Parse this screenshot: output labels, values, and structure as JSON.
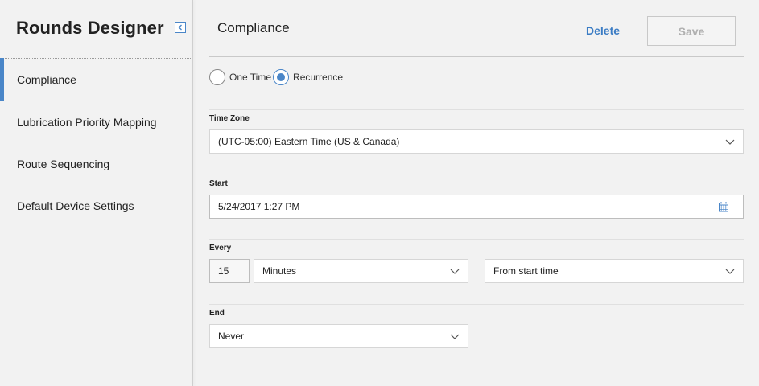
{
  "sidebar": {
    "title": "Rounds Designer",
    "items": [
      {
        "label": "Compliance",
        "active": true
      },
      {
        "label": "Lubrication Priority Mapping",
        "active": false
      },
      {
        "label": "Route Sequencing",
        "active": false
      },
      {
        "label": "Default Device Settings",
        "active": false
      }
    ],
    "collapse_icon": "collapse-left-icon"
  },
  "header": {
    "title": "Compliance",
    "delete_label": "Delete",
    "save_label": "Save"
  },
  "schedule_type": {
    "options": [
      "One Time",
      "Recurrence"
    ],
    "selected": "Recurrence"
  },
  "time_zone": {
    "label": "Time Zone",
    "value": "(UTC-05:00) Eastern Time (US & Canada)"
  },
  "start": {
    "label": "Start",
    "value": "5/24/2017 1:27 PM"
  },
  "every": {
    "label": "Every",
    "count": "15",
    "unit": "Minutes",
    "basis": "From start time"
  },
  "end": {
    "label": "End",
    "value": "Never"
  },
  "colors": {
    "accent": "#4a86c8",
    "background": "#f2f2f2"
  }
}
